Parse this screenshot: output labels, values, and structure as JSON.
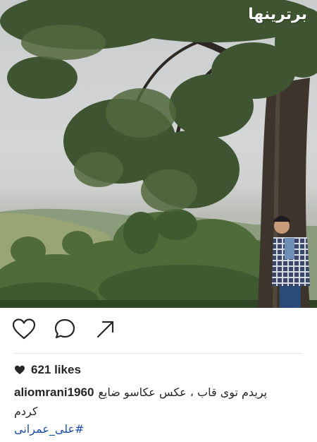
{
  "post": {
    "watermark": "برترینها",
    "likes": "621 likes",
    "username": "aliomrani1960",
    "caption_line1": "پریدم توی قاب ، عکس عکاسو ضایع",
    "caption_line2": "کردم",
    "hashtag": "#علی_عمرانی"
  },
  "actions": {
    "like_icon": "heart-outline-icon",
    "comment_icon": "comment-bubble-icon",
    "share_icon": "share-arrow-icon"
  },
  "colors": {
    "text": "#262626",
    "hashtag": "#1c4ea1",
    "divider": "#e6e6e6"
  }
}
